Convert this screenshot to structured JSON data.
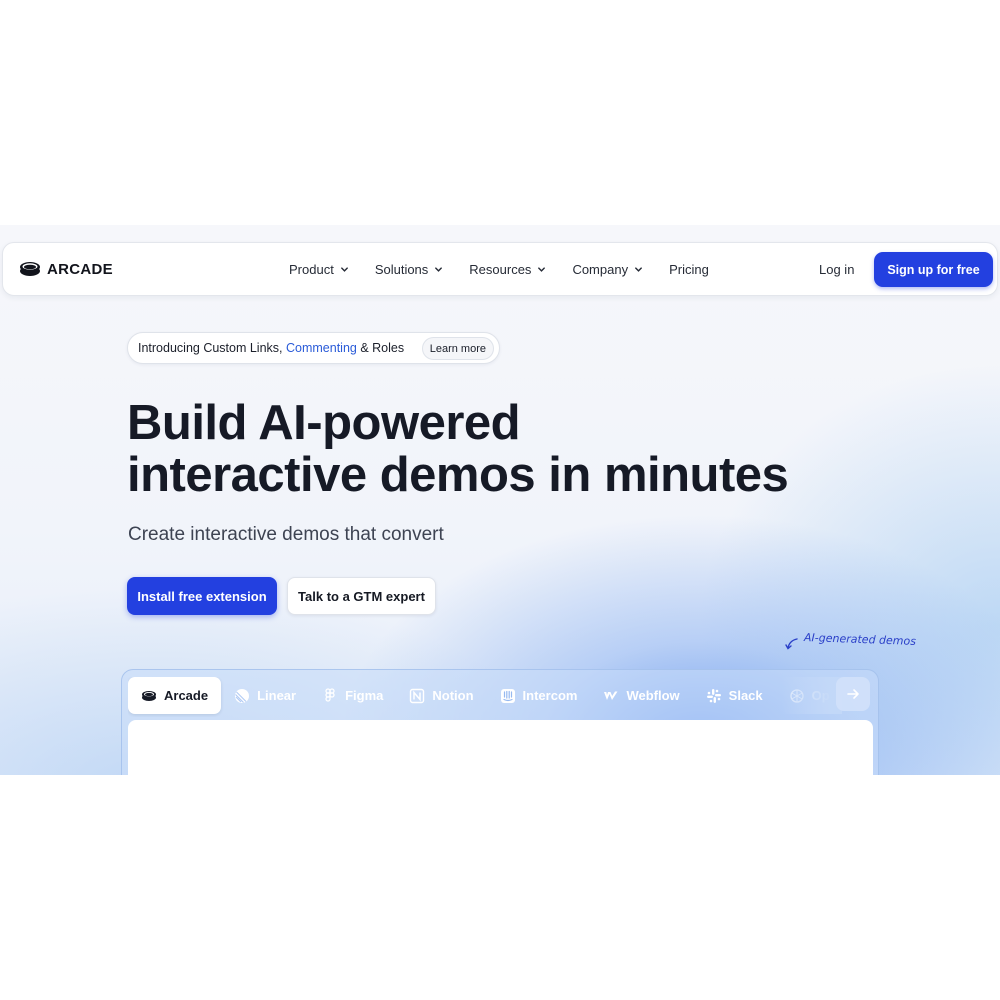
{
  "brand": {
    "name": "ARCADE"
  },
  "nav": {
    "items": [
      {
        "label": "Product",
        "has_dropdown": true
      },
      {
        "label": "Solutions",
        "has_dropdown": true
      },
      {
        "label": "Resources",
        "has_dropdown": true
      },
      {
        "label": "Company",
        "has_dropdown": true
      },
      {
        "label": "Pricing",
        "has_dropdown": false
      }
    ],
    "login_label": "Log in",
    "signup_label": "Sign up for free"
  },
  "announcement": {
    "prefix": "Introducing Custom Links, ",
    "highlight": "Commenting",
    "suffix": " & Roles",
    "cta_label": "Learn more"
  },
  "hero": {
    "title_line1": "Build AI-powered",
    "title_line2": "interactive demos in minutes",
    "subtitle": "Create interactive demos that convert",
    "primary_cta": "Install free extension",
    "secondary_cta": "Talk to a GTM expert",
    "annotation": "AI-generated demos"
  },
  "demo_tabs": [
    {
      "label": "Arcade",
      "icon": "arcade-icon",
      "active": true
    },
    {
      "label": "Linear",
      "icon": "linear-icon",
      "active": false
    },
    {
      "label": "Figma",
      "icon": "figma-icon",
      "active": false
    },
    {
      "label": "Notion",
      "icon": "notion-icon",
      "active": false
    },
    {
      "label": "Intercom",
      "icon": "intercom-icon",
      "active": false
    },
    {
      "label": "Webflow",
      "icon": "webflow-icon",
      "active": false
    },
    {
      "label": "Slack",
      "icon": "slack-icon",
      "active": false
    },
    {
      "label": "Op",
      "icon": "openai-icon",
      "active": false
    }
  ],
  "colors": {
    "accent": "#2340e0",
    "link": "#2a5bd8",
    "text": "#161a26"
  }
}
